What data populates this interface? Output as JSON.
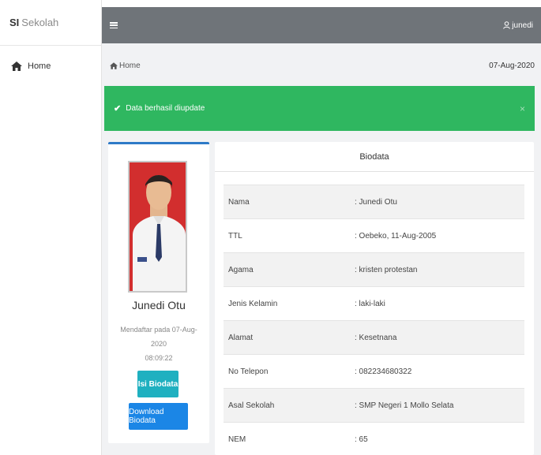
{
  "sidebar": {
    "brand_bold": "SI",
    "brand_rest": "Sekolah",
    "items": [
      {
        "label": "Home",
        "icon": "home-icon"
      }
    ]
  },
  "topbar": {
    "username": "junedi"
  },
  "breadcrumb": {
    "label": "Home",
    "date": "07-Aug-2020"
  },
  "alert": {
    "message": "Data berhasil diupdate",
    "close": "×",
    "color": "#2fb760"
  },
  "profile": {
    "name": "Junedi Otu",
    "registered_line1": "Mendaftar pada 07-Aug-2020",
    "registered_line2": "08:09:22",
    "isi_button": "Isi Biodata",
    "download_button": "Download Biodata"
  },
  "biodata": {
    "title": "Biodata",
    "rows": [
      {
        "label": "Nama",
        "value": ": Junedi Otu"
      },
      {
        "label": "TTL",
        "value": ": Oebeko, 11-Aug-2005"
      },
      {
        "label": "Agama",
        "value": ": kristen protestan"
      },
      {
        "label": "Jenis Kelamin",
        "value": ": laki-laki"
      },
      {
        "label": "Alamat",
        "value": ": Kesetnana"
      },
      {
        "label": "No Telepon",
        "value": ": 082234680322"
      },
      {
        "label": "Asal Sekolah",
        "value": ": SMP Negeri 1 Mollo Selata"
      },
      {
        "label": "NEM",
        "value": ": 65"
      }
    ]
  },
  "colors": {
    "topbar": "#6f7479",
    "accent": "#2e7ac7",
    "info_button": "#1fb0c0",
    "primary_button": "#1b86e6"
  }
}
